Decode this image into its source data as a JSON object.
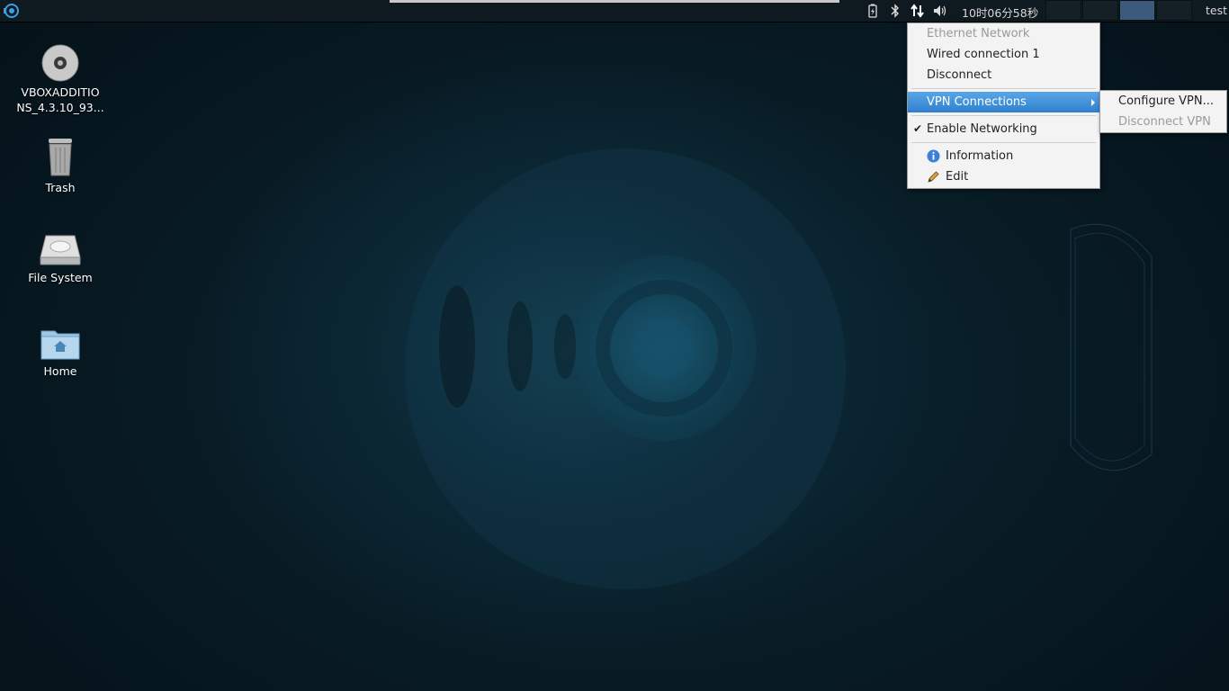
{
  "panel": {
    "clock": "10时06分58秒",
    "user": "test"
  },
  "desktop": {
    "icons": [
      {
        "label_line1": "VBOXADDITIO",
        "label_line2": "NS_4.3.10_93..."
      },
      {
        "label": "Trash"
      },
      {
        "label": "File System"
      },
      {
        "label": "Home"
      }
    ]
  },
  "network_menu": {
    "items": [
      {
        "label": "Ethernet Network",
        "state": "disabled"
      },
      {
        "label": "Wired connection 1"
      },
      {
        "label": "Disconnect"
      },
      {
        "label": "VPN Connections",
        "state": "highlighted"
      },
      {
        "label": "Enable Networking",
        "checked": true
      },
      {
        "label": "Information",
        "icon": "info-icon"
      },
      {
        "label": "Edit",
        "icon": "pencil-icon"
      }
    ]
  },
  "vpn_submenu": {
    "items": [
      {
        "label": "Configure VPN..."
      },
      {
        "label": "Disconnect VPN",
        "state": "disabled"
      }
    ]
  },
  "colors": {
    "highlight": "#2f80cf",
    "panel": "#0f1a20",
    "active_workspace": "#3c5a7c"
  }
}
